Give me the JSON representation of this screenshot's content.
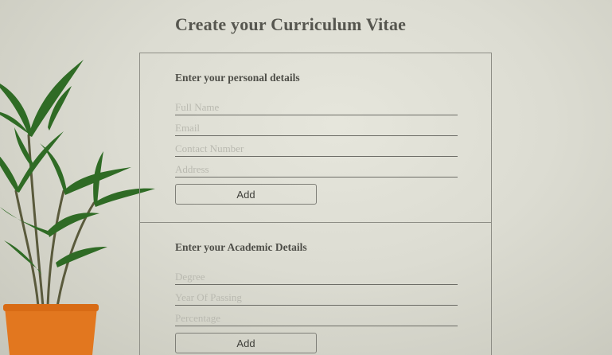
{
  "page": {
    "title": "Create your Curriculum Vitae"
  },
  "personal": {
    "heading": "Enter your personal details",
    "fields": {
      "full_name": "Full Name",
      "email": "Email",
      "contact_number": "Contact Number",
      "address": "Address"
    },
    "add_label": "Add"
  },
  "academic": {
    "heading": "Enter your Academic Details",
    "fields": {
      "degree": "Degree",
      "year_of_passing": "Year Of Passing",
      "percentage": "Percentage"
    },
    "add_label": "Add"
  },
  "colors": {
    "background": "#dcdcd2",
    "text": "#4e4e48",
    "border": "#8e8e86",
    "pot": "#e2771f",
    "leaf": "#2f6b25"
  }
}
